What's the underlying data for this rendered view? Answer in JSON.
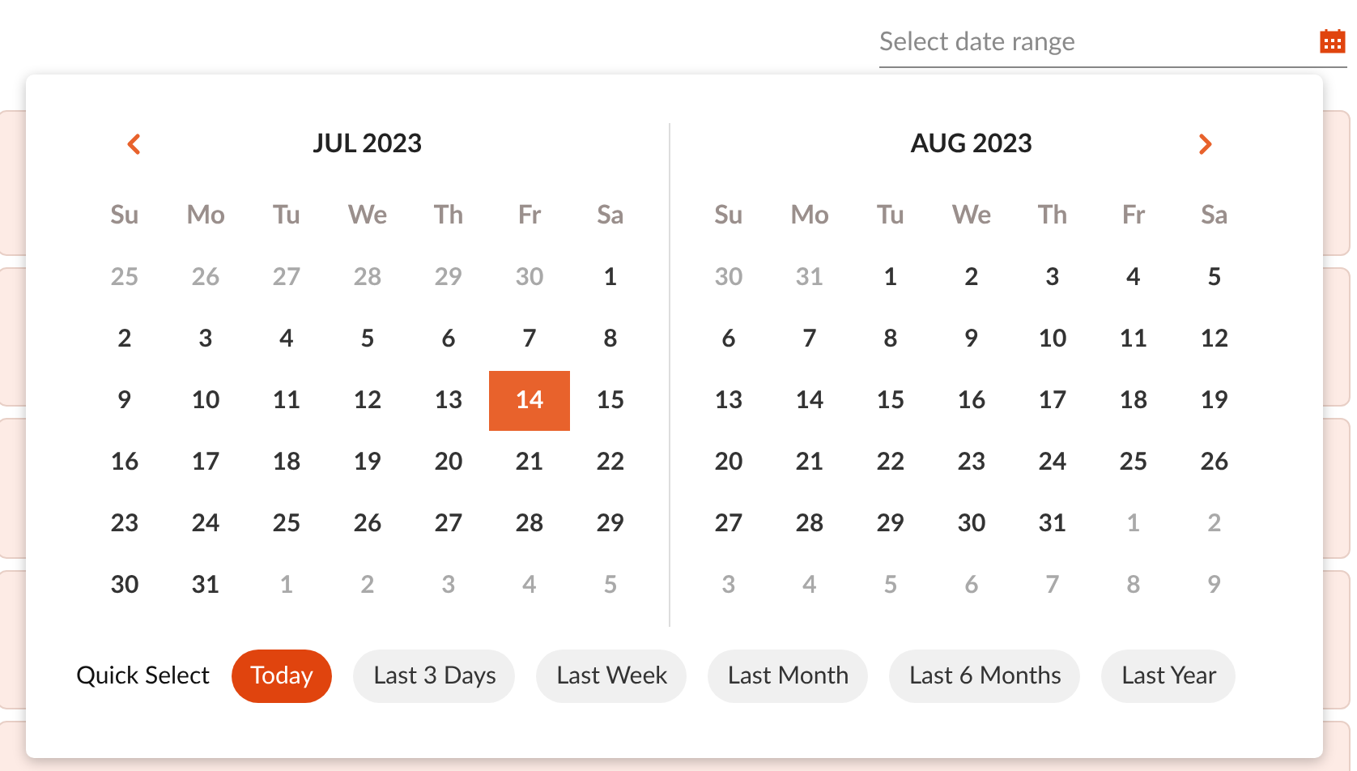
{
  "date_field": {
    "placeholder": "Select date range"
  },
  "months": [
    {
      "title": "JUL 2023",
      "has_prev": true,
      "has_next": false,
      "weekdays": [
        "Su",
        "Mo",
        "Tu",
        "We",
        "Th",
        "Fr",
        "Sa"
      ],
      "weeks": [
        [
          {
            "day": "25",
            "outside": true,
            "selected": false
          },
          {
            "day": "26",
            "outside": true,
            "selected": false
          },
          {
            "day": "27",
            "outside": true,
            "selected": false
          },
          {
            "day": "28",
            "outside": true,
            "selected": false
          },
          {
            "day": "29",
            "outside": true,
            "selected": false
          },
          {
            "day": "30",
            "outside": true,
            "selected": false
          },
          {
            "day": "1",
            "outside": false,
            "selected": false
          }
        ],
        [
          {
            "day": "2",
            "outside": false,
            "selected": false
          },
          {
            "day": "3",
            "outside": false,
            "selected": false
          },
          {
            "day": "4",
            "outside": false,
            "selected": false
          },
          {
            "day": "5",
            "outside": false,
            "selected": false
          },
          {
            "day": "6",
            "outside": false,
            "selected": false
          },
          {
            "day": "7",
            "outside": false,
            "selected": false
          },
          {
            "day": "8",
            "outside": false,
            "selected": false
          }
        ],
        [
          {
            "day": "9",
            "outside": false,
            "selected": false
          },
          {
            "day": "10",
            "outside": false,
            "selected": false
          },
          {
            "day": "11",
            "outside": false,
            "selected": false
          },
          {
            "day": "12",
            "outside": false,
            "selected": false
          },
          {
            "day": "13",
            "outside": false,
            "selected": false
          },
          {
            "day": "14",
            "outside": false,
            "selected": true
          },
          {
            "day": "15",
            "outside": false,
            "selected": false
          }
        ],
        [
          {
            "day": "16",
            "outside": false,
            "selected": false
          },
          {
            "day": "17",
            "outside": false,
            "selected": false
          },
          {
            "day": "18",
            "outside": false,
            "selected": false
          },
          {
            "day": "19",
            "outside": false,
            "selected": false
          },
          {
            "day": "20",
            "outside": false,
            "selected": false
          },
          {
            "day": "21",
            "outside": false,
            "selected": false
          },
          {
            "day": "22",
            "outside": false,
            "selected": false
          }
        ],
        [
          {
            "day": "23",
            "outside": false,
            "selected": false
          },
          {
            "day": "24",
            "outside": false,
            "selected": false
          },
          {
            "day": "25",
            "outside": false,
            "selected": false
          },
          {
            "day": "26",
            "outside": false,
            "selected": false
          },
          {
            "day": "27",
            "outside": false,
            "selected": false
          },
          {
            "day": "28",
            "outside": false,
            "selected": false
          },
          {
            "day": "29",
            "outside": false,
            "selected": false
          }
        ],
        [
          {
            "day": "30",
            "outside": false,
            "selected": false
          },
          {
            "day": "31",
            "outside": false,
            "selected": false
          },
          {
            "day": "1",
            "outside": true,
            "selected": false
          },
          {
            "day": "2",
            "outside": true,
            "selected": false
          },
          {
            "day": "3",
            "outside": true,
            "selected": false
          },
          {
            "day": "4",
            "outside": true,
            "selected": false
          },
          {
            "day": "5",
            "outside": true,
            "selected": false
          }
        ]
      ]
    },
    {
      "title": "AUG 2023",
      "has_prev": false,
      "has_next": true,
      "weekdays": [
        "Su",
        "Mo",
        "Tu",
        "We",
        "Th",
        "Fr",
        "Sa"
      ],
      "weeks": [
        [
          {
            "day": "30",
            "outside": true,
            "selected": false
          },
          {
            "day": "31",
            "outside": true,
            "selected": false
          },
          {
            "day": "1",
            "outside": false,
            "selected": false
          },
          {
            "day": "2",
            "outside": false,
            "selected": false
          },
          {
            "day": "3",
            "outside": false,
            "selected": false
          },
          {
            "day": "4",
            "outside": false,
            "selected": false
          },
          {
            "day": "5",
            "outside": false,
            "selected": false
          }
        ],
        [
          {
            "day": "6",
            "outside": false,
            "selected": false
          },
          {
            "day": "7",
            "outside": false,
            "selected": false
          },
          {
            "day": "8",
            "outside": false,
            "selected": false
          },
          {
            "day": "9",
            "outside": false,
            "selected": false
          },
          {
            "day": "10",
            "outside": false,
            "selected": false
          },
          {
            "day": "11",
            "outside": false,
            "selected": false
          },
          {
            "day": "12",
            "outside": false,
            "selected": false
          }
        ],
        [
          {
            "day": "13",
            "outside": false,
            "selected": false
          },
          {
            "day": "14",
            "outside": false,
            "selected": false
          },
          {
            "day": "15",
            "outside": false,
            "selected": false
          },
          {
            "day": "16",
            "outside": false,
            "selected": false
          },
          {
            "day": "17",
            "outside": false,
            "selected": false
          },
          {
            "day": "18",
            "outside": false,
            "selected": false
          },
          {
            "day": "19",
            "outside": false,
            "selected": false
          }
        ],
        [
          {
            "day": "20",
            "outside": false,
            "selected": false
          },
          {
            "day": "21",
            "outside": false,
            "selected": false
          },
          {
            "day": "22",
            "outside": false,
            "selected": false
          },
          {
            "day": "23",
            "outside": false,
            "selected": false
          },
          {
            "day": "24",
            "outside": false,
            "selected": false
          },
          {
            "day": "25",
            "outside": false,
            "selected": false
          },
          {
            "day": "26",
            "outside": false,
            "selected": false
          }
        ],
        [
          {
            "day": "27",
            "outside": false,
            "selected": false
          },
          {
            "day": "28",
            "outside": false,
            "selected": false
          },
          {
            "day": "29",
            "outside": false,
            "selected": false
          },
          {
            "day": "30",
            "outside": false,
            "selected": false
          },
          {
            "day": "31",
            "outside": false,
            "selected": false
          },
          {
            "day": "1",
            "outside": true,
            "selected": false
          },
          {
            "day": "2",
            "outside": true,
            "selected": false
          }
        ],
        [
          {
            "day": "3",
            "outside": true,
            "selected": false
          },
          {
            "day": "4",
            "outside": true,
            "selected": false
          },
          {
            "day": "5",
            "outside": true,
            "selected": false
          },
          {
            "day": "6",
            "outside": true,
            "selected": false
          },
          {
            "day": "7",
            "outside": true,
            "selected": false
          },
          {
            "day": "8",
            "outside": true,
            "selected": false
          },
          {
            "day": "9",
            "outside": true,
            "selected": false
          }
        ]
      ]
    }
  ],
  "quick_select": {
    "label": "Quick Select",
    "options": [
      {
        "label": "Today",
        "selected": true
      },
      {
        "label": "Last 3 Days",
        "selected": false
      },
      {
        "label": "Last Week",
        "selected": false
      },
      {
        "label": "Last Month",
        "selected": false
      },
      {
        "label": "Last 6 Months",
        "selected": false
      },
      {
        "label": "Last Year",
        "selected": false
      }
    ]
  }
}
